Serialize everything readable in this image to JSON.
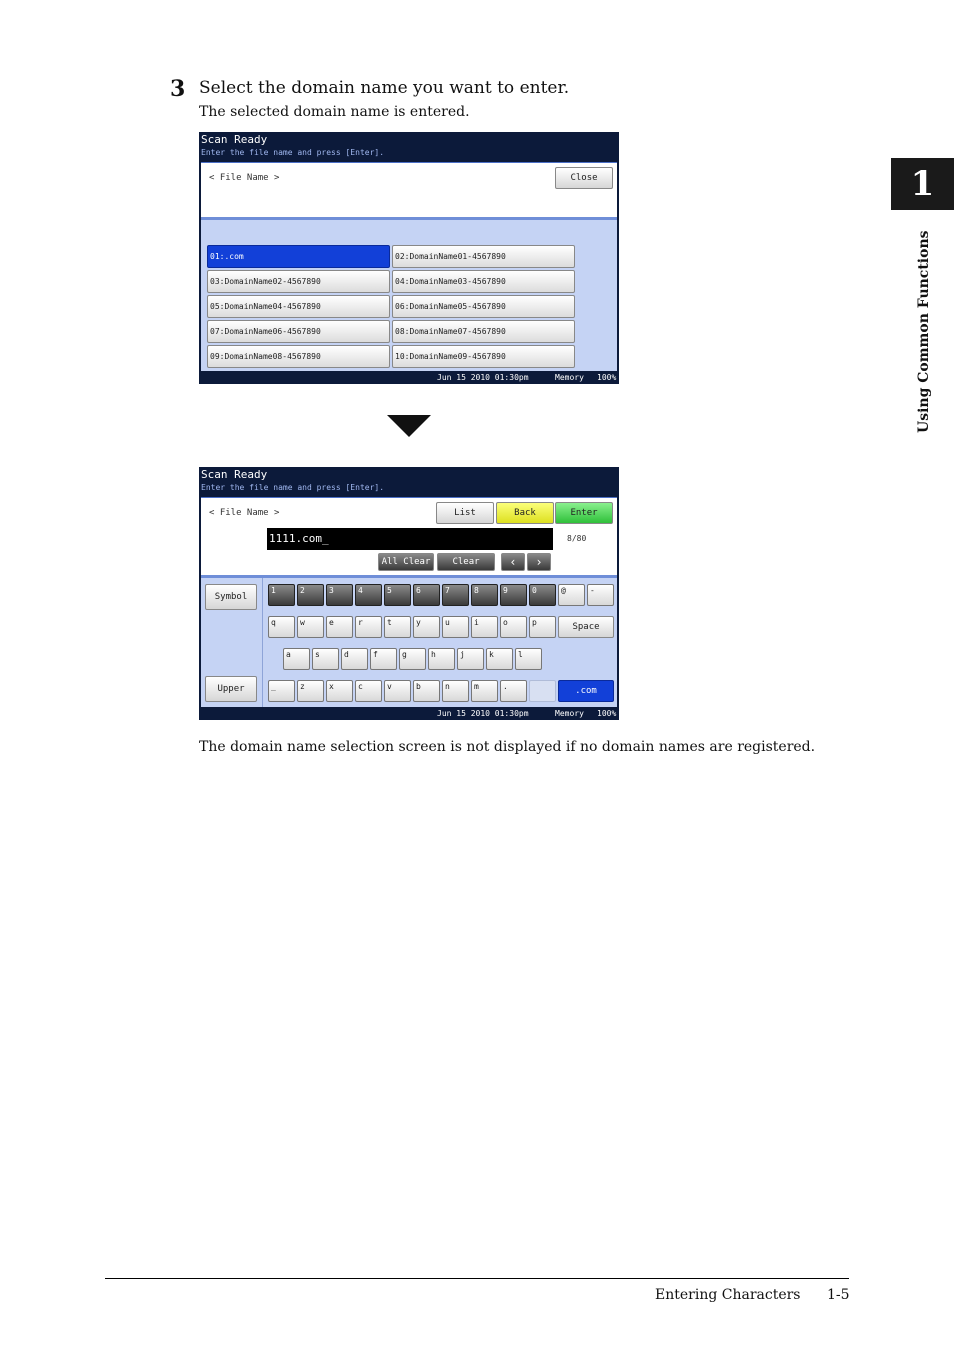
{
  "step": {
    "number": "3",
    "title": "Select the domain name you want to enter.",
    "subtitle": "The selected domain name is entered."
  },
  "chapter": {
    "number": "1",
    "label": "Using Common Functions"
  },
  "note": "The domain name selection screen is not displayed if no domain names are registered.",
  "footer": {
    "section": "Entering Characters",
    "page": "1-5"
  },
  "screen1": {
    "title": "Scan Ready",
    "subtitle": "Enter the file name and press [Enter].",
    "field_label": "< File Name >",
    "close": "Close",
    "domains": [
      "01:.com",
      "02:DomainName01-4567890",
      "03:DomainName02-4567890",
      "04:DomainName03-4567890",
      "05:DomainName04-4567890",
      "06:DomainName05-4567890",
      "07:DomainName06-4567890",
      "08:DomainName07-4567890",
      "09:DomainName08-4567890",
      "10:DomainName09-4567890"
    ],
    "status": {
      "datetime": "Jun 15 2010 01:30pm",
      "memory": "Memory",
      "percent": "100%"
    }
  },
  "screen2": {
    "title": "Scan Ready",
    "subtitle": "Enter the file name and press [Enter].",
    "field_label": "< File Name >",
    "list": "List",
    "back": "Back",
    "enter": "Enter",
    "input_value": "1111.com_",
    "counter": "8/80",
    "all_clear": "All Clear",
    "clear": "Clear",
    "symbol": "Symbol",
    "upper": "Upper",
    "space": "Space",
    "dotcom": ".com",
    "row1": [
      "1",
      "2",
      "3",
      "4",
      "5",
      "6",
      "7",
      "8",
      "9",
      "0",
      "@",
      "-"
    ],
    "row2": [
      "q",
      "w",
      "e",
      "r",
      "t",
      "y",
      "u",
      "i",
      "o",
      "p"
    ],
    "row3": [
      "a",
      "s",
      "d",
      "f",
      "g",
      "h",
      "j",
      "k",
      "l"
    ],
    "row4": [
      "_",
      "z",
      "x",
      "c",
      "v",
      "b",
      "n",
      "m",
      "."
    ],
    "status": {
      "datetime": "Jun 15 2010 01:30pm",
      "memory": "Memory",
      "percent": "100%"
    }
  }
}
